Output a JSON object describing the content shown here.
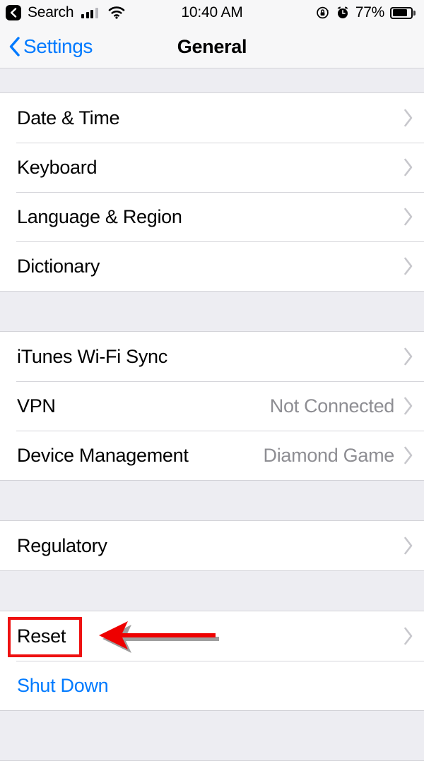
{
  "status_bar": {
    "back_app_icon": "chevron-left-icon",
    "back_app_label": "Search",
    "cellular_icon": "cellular-signal-icon",
    "wifi_icon": "wifi-icon",
    "time": "10:40 AM",
    "rotation_lock_icon": "rotation-lock-icon",
    "alarm_icon": "alarm-clock-icon",
    "battery_percent": "77%",
    "battery_level": 77,
    "battery_icon": "battery-icon"
  },
  "nav_bar": {
    "back_icon": "chevron-left-icon",
    "back_label": "Settings",
    "title": "General"
  },
  "sections": [
    {
      "rows": [
        {
          "label": "Date & Time",
          "detail": "",
          "accessory": "chevron-right-icon",
          "style": "default"
        },
        {
          "label": "Keyboard",
          "detail": "",
          "accessory": "chevron-right-icon",
          "style": "default"
        },
        {
          "label": "Language & Region",
          "detail": "",
          "accessory": "chevron-right-icon",
          "style": "default"
        },
        {
          "label": "Dictionary",
          "detail": "",
          "accessory": "chevron-right-icon",
          "style": "default"
        }
      ]
    },
    {
      "rows": [
        {
          "label": "iTunes Wi-Fi Sync",
          "detail": "",
          "accessory": "chevron-right-icon",
          "style": "default"
        },
        {
          "label": "VPN",
          "detail": "Not Connected",
          "accessory": "chevron-right-icon",
          "style": "default"
        },
        {
          "label": "Device Management",
          "detail": "Diamond Game",
          "accessory": "chevron-right-icon",
          "style": "default"
        }
      ]
    },
    {
      "rows": [
        {
          "label": "Regulatory",
          "detail": "",
          "accessory": "chevron-right-icon",
          "style": "default"
        }
      ]
    },
    {
      "rows": [
        {
          "label": "Reset",
          "detail": "",
          "accessory": "chevron-right-icon",
          "style": "default"
        },
        {
          "label": "Shut Down",
          "detail": "",
          "accessory": "",
          "style": "blue"
        }
      ]
    }
  ],
  "annotations": {
    "highlight_target": "Reset",
    "highlight_color": "#ee1111",
    "arrow_color": "#ee0000",
    "arrow_direction": "left"
  },
  "colors": {
    "accent_blue": "#007aff",
    "group_background": "#ededf2",
    "row_background": "#ffffff",
    "detail_gray": "#8e8e93",
    "chevron_gray": "#c7c7cc",
    "separator": "#d5d5da"
  }
}
